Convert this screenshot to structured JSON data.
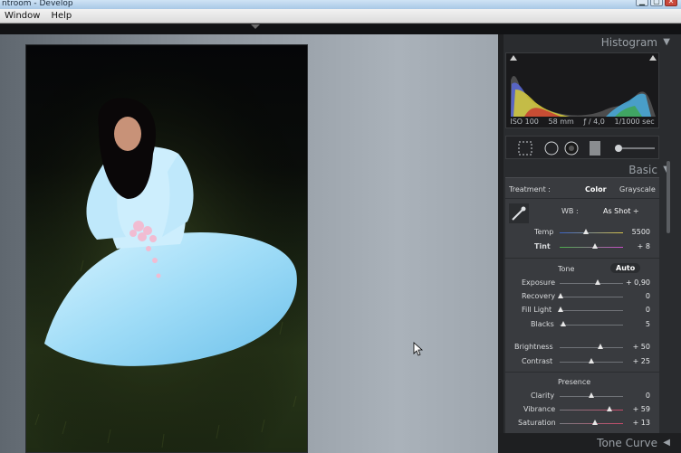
{
  "window": {
    "title": "ntroom - Develop",
    "controls": {
      "minimize": "▁",
      "maximize": "▢",
      "close": "✕"
    }
  },
  "menubar": {
    "items": [
      "Window",
      "Help"
    ]
  },
  "histogram": {
    "title": "Histogram",
    "iso": "ISO 100",
    "focal": "58 mm",
    "aperture": "ƒ / 4,0",
    "shutter": "1/1000 sec"
  },
  "basic": {
    "title": "Basic",
    "treatment_label": "Treatment :",
    "color_label": "Color",
    "grayscale_label": "Grayscale",
    "wb_label": "WB :",
    "wb_value": "As Shot ÷",
    "temp": {
      "label": "Temp",
      "value": "5500",
      "level": 0.42
    },
    "tint": {
      "label": "Tint",
      "value": "+ 8",
      "level": 0.55
    },
    "tone_label": "Tone",
    "auto_label": "Auto",
    "exposure": {
      "label": "Exposure",
      "value": "+ 0,90",
      "level": 0.6
    },
    "recovery": {
      "label": "Recovery",
      "value": "0",
      "level": 0.02
    },
    "fill_light": {
      "label": "Fill Light",
      "value": "0",
      "level": 0.02
    },
    "blacks": {
      "label": "Blacks",
      "value": "5",
      "level": 0.06
    },
    "brightness": {
      "label": "Brightness",
      "value": "+ 50",
      "level": 0.64
    },
    "contrast": {
      "label": "Contrast",
      "value": "+ 25",
      "level": 0.5
    },
    "presence_label": "Presence",
    "clarity": {
      "label": "Clarity",
      "value": "0",
      "level": 0.5
    },
    "vibrance": {
      "label": "Vibrance",
      "value": "+ 59",
      "level": 0.78
    },
    "saturation": {
      "label": "Saturation",
      "value": "+ 13",
      "level": 0.56
    }
  },
  "tone_curve": {
    "title": "Tone Curve"
  },
  "icons": {
    "histogram_collapse": "triangle-down-icon",
    "basic_collapse": "triangle-down-icon",
    "tone_curve_expand": "triangle-left-icon",
    "crop": "crop-icon",
    "spot_removal": "spot-removal-icon",
    "red_eye": "red-eye-icon",
    "graduated_filter": "graduated-filter-icon",
    "adjustment_brush": "adjustment-brush-icon",
    "eyedropper": "eyedropper-icon"
  },
  "colors": {
    "accent_text": "#e8eaec",
    "panel": "#393b3f",
    "panel_dark": "#2a2c2f"
  }
}
